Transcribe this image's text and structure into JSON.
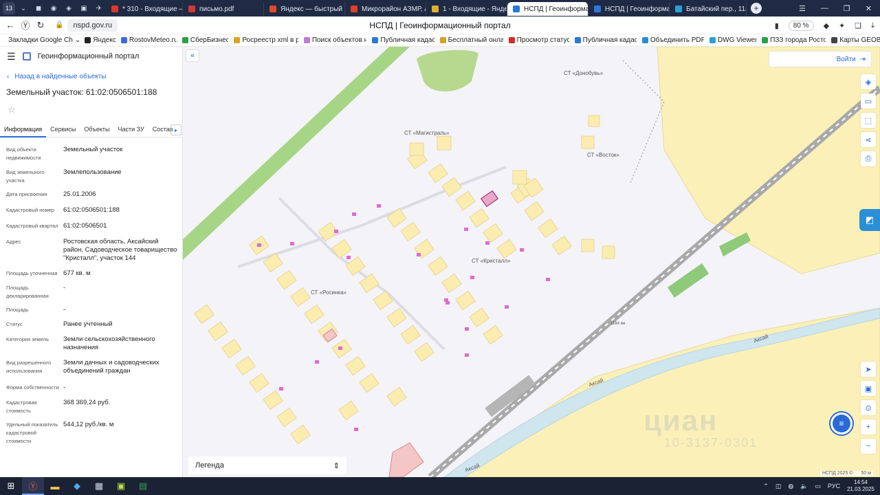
{
  "browser": {
    "tab_counter": "13",
    "tabs": [
      {
        "label": "* 310 - Входящие — Я",
        "color": "#d63a2a"
      },
      {
        "label": "письмо.pdf",
        "color": "#d13838"
      },
      {
        "label": "Яндекс — быстрый по",
        "color": "#e04a2a"
      },
      {
        "label": "Микрорайон АЗМР, А",
        "color": "#e0402a"
      },
      {
        "label": "1 - Входящие - Яндек",
        "color": "#e0b02a"
      },
      {
        "label": "НСПД | Геоинформа",
        "color": "#2a78d6",
        "active": true
      },
      {
        "label": "НСПД | Геоинформац",
        "color": "#2a78d6"
      },
      {
        "label": "Батайский пер., 11а -",
        "color": "#2aa0d6"
      }
    ],
    "url": "nspd.gov.ru",
    "page_title": "НСПД | Геоинформационный портал",
    "zoom": "80 %",
    "bookmarks": [
      {
        "label": "Закладки Google Ch",
        "color": "#999999"
      },
      {
        "label": "Яндекс",
        "color": "#222222"
      },
      {
        "label": "RostovMeteo.ru",
        "color": "#3a6ad6"
      },
      {
        "label": "СберБизнес",
        "color": "#2aa04a"
      },
      {
        "label": "Росреестр xml в р",
        "color": "#e0a02a"
      },
      {
        "label": "Поиск объектов н",
        "color": "#c07ad6"
      },
      {
        "label": "Публичная кадас",
        "color": "#2a78d6"
      },
      {
        "label": "Бесплатный онла",
        "color": "#d6a02a"
      },
      {
        "label": "Просмотр статус",
        "color": "#d62a2a"
      },
      {
        "label": "Публичная кадас",
        "color": "#2a78d6"
      },
      {
        "label": "Объединить PDF",
        "color": "#2a8ad6"
      },
      {
        "label": "DWG Viewer",
        "color": "#2aa0d6"
      },
      {
        "label": "ПЗЗ города Росто",
        "color": "#2aa04a"
      },
      {
        "label": "Карты GEOB",
        "color": "#444444"
      }
    ]
  },
  "sidebar": {
    "portal_title": "Геоинформационный портал",
    "back_link": "Назад в найденные объекты",
    "title": "Земельный участок: 61:02:0506501:188",
    "tabs": [
      "Информация",
      "Сервисы",
      "Объекты",
      "Части ЗУ",
      "Состав"
    ],
    "properties": [
      {
        "k": "Вид объекта недвижимости",
        "v": "Земельный участок"
      },
      {
        "k": "Вид земельного участка",
        "v": "Землепользование"
      },
      {
        "k": "Дата присвоения",
        "v": "25.01.2006"
      },
      {
        "k": "Кадастровый номер",
        "v": "61:02:0506501:188"
      },
      {
        "k": "Кадастровый квартал",
        "v": "61:02:0506501"
      },
      {
        "k": "Адрес",
        "v": "Ростовская область, Аксайский район, Садоводческое товарищество \"Кристалл\", участок 144"
      },
      {
        "k": "Площадь уточненная",
        "v": "677 кв. м"
      },
      {
        "k": "Площадь декларированная",
        "v": "-"
      },
      {
        "k": "Площадь",
        "v": "-"
      },
      {
        "k": "Статус",
        "v": "Ранее учтенный"
      },
      {
        "k": "Категория земель",
        "v": "Земли сельскохозяйственного назначения"
      },
      {
        "k": "Вид разрешенного использования",
        "v": "Земли дачных и садоводческих объединений граждан"
      },
      {
        "k": "Форма собственности",
        "v": "-"
      },
      {
        "k": "Кадастровая стоимость",
        "v": "368 369,24 руб."
      },
      {
        "k": "Удельный показатель кадастровой стоимости",
        "v": "544,12 руб./кв. м"
      }
    ]
  },
  "map": {
    "login": "Войти",
    "labels": {
      "donobuv": "СТ «Донобувь»",
      "magistral": "СТ «Магистраль»",
      "vostok": "СТ «Восток»",
      "kristall": "СТ «Кристалл»",
      "rosinka": "СТ «Росинка»",
      "aksai1": "Аксай",
      "aksai2": "Аксай",
      "aksai3": "Аксай",
      "km": "1184 км"
    },
    "legend": "Легенда",
    "attribution": "НСПД 2025 ©",
    "scale": "50 м",
    "watermark": "циан",
    "watermark_id": "10-3137-0301"
  },
  "taskbar": {
    "lang": "РУС",
    "time": "14:54",
    "date": "21.03.2025"
  }
}
